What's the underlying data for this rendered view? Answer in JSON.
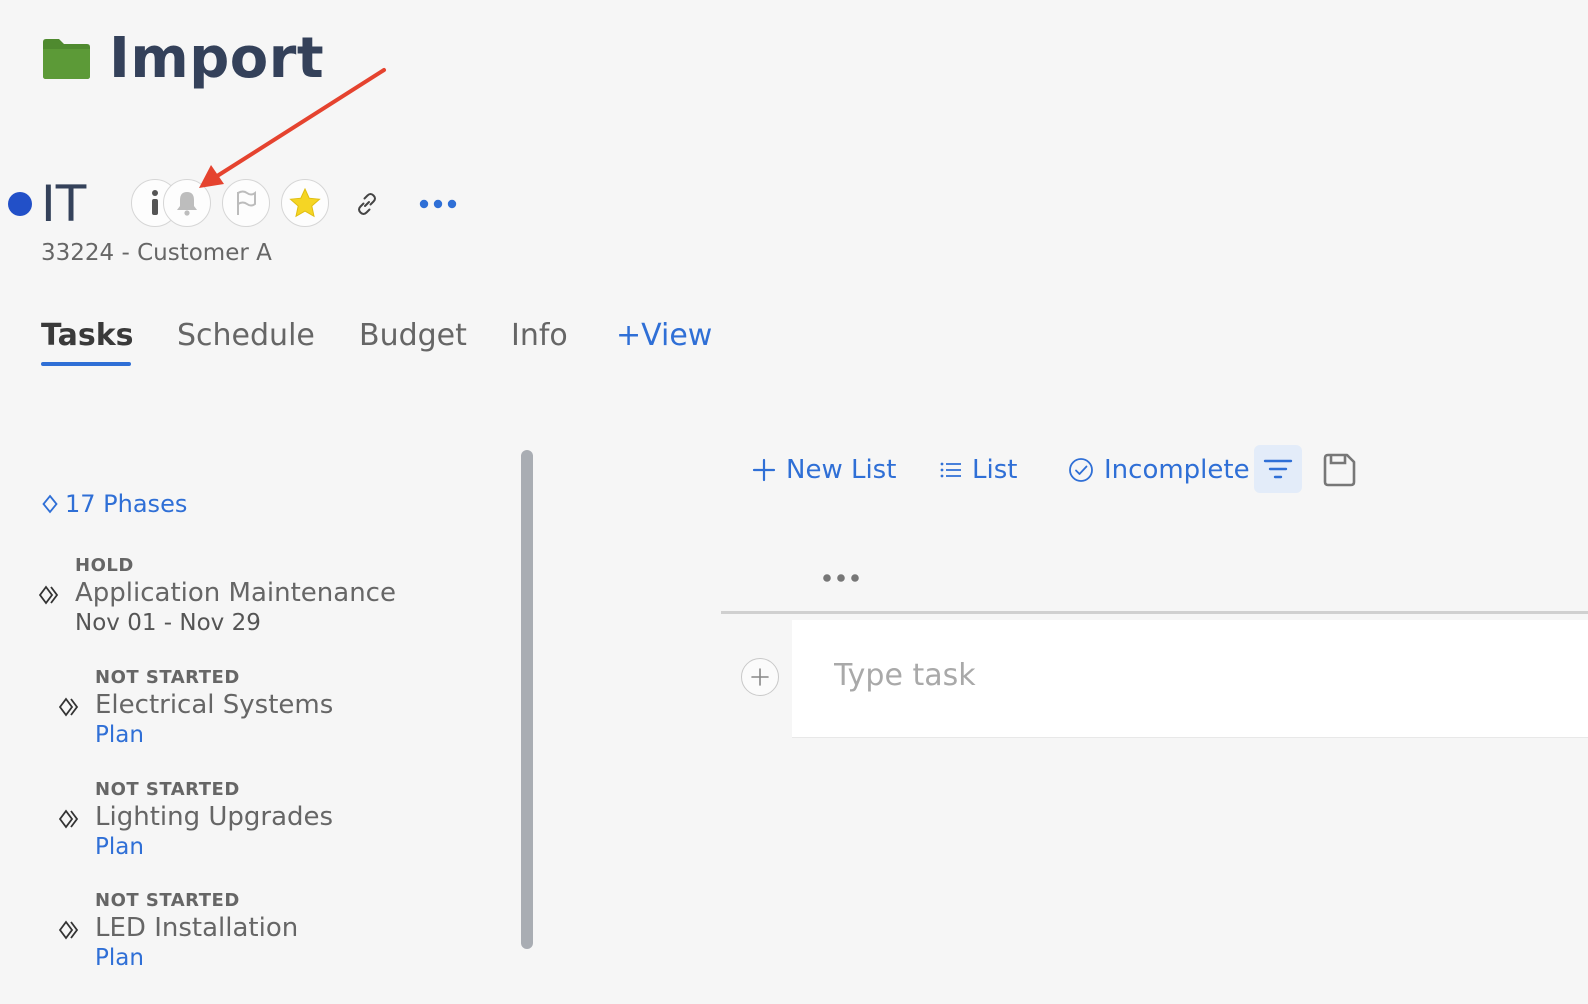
{
  "folder": {
    "title": "Import",
    "icon": "folder-icon",
    "color": "#4f8a2f"
  },
  "project": {
    "name": "IT",
    "status_color": "#2250c8",
    "subtitle": "33224 - Customer A",
    "actions": [
      "info-icon",
      "bell-icon",
      "flag-icon",
      "star-icon",
      "link-icon",
      "more-icon"
    ]
  },
  "tabs": [
    {
      "label": "Tasks",
      "active": true
    },
    {
      "label": "Schedule"
    },
    {
      "label": "Budget"
    },
    {
      "label": "Info"
    },
    {
      "label": "+View"
    }
  ],
  "phases": {
    "header": "17 Phases",
    "items": [
      {
        "status": "HOLD",
        "name": "Application Maintenance",
        "detail": "Nov 01 - Nov 29"
      },
      {
        "status": "NOT STARTED",
        "name": "Electrical Systems",
        "detail": "Plan"
      },
      {
        "status": "NOT STARTED",
        "name": "Lighting Upgrades",
        "detail": "Plan"
      },
      {
        "status": "NOT STARTED",
        "name": "LED Installation",
        "detail": "Plan"
      }
    ]
  },
  "toolbar": {
    "new_list": "New List",
    "view_mode": "List",
    "completion_filter": "Incomplete"
  },
  "task_entry": {
    "placeholder": "Type task"
  },
  "colors": {
    "accent": "#2f6fd6",
    "annotation_arrow": "#e5432f",
    "star": "#f5d524"
  }
}
